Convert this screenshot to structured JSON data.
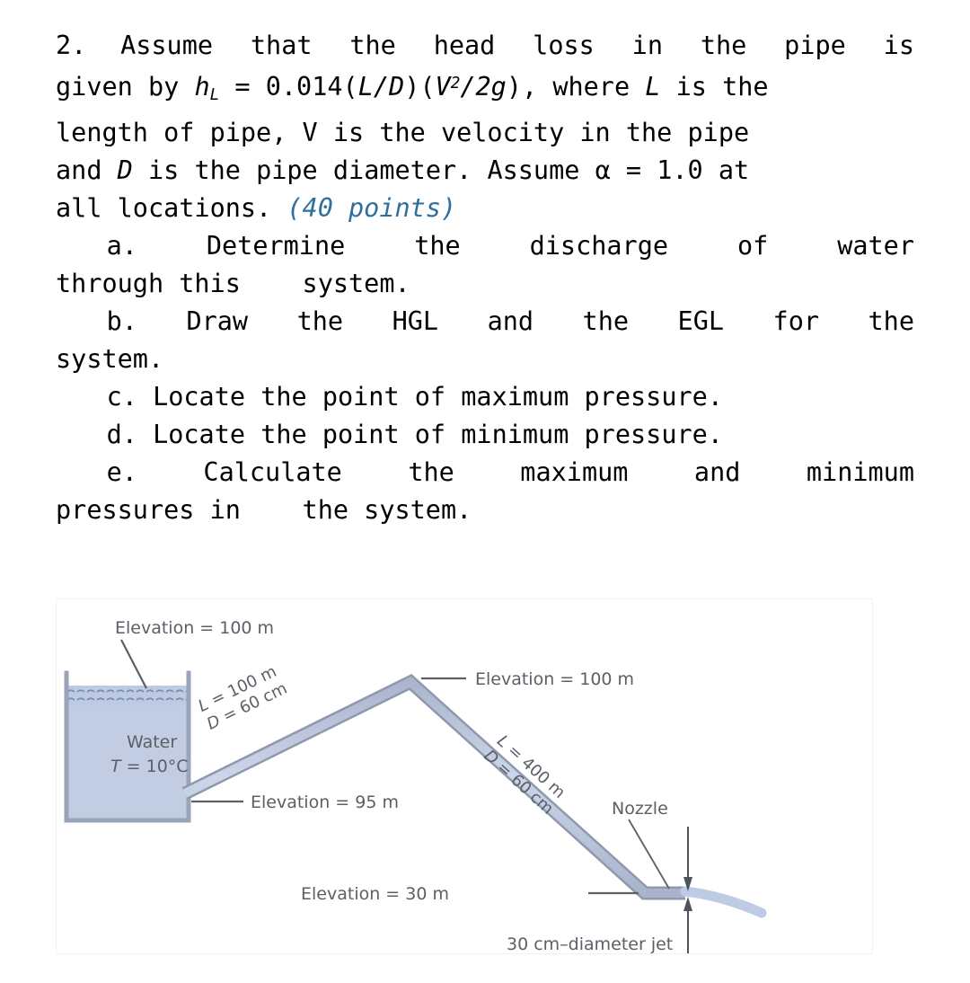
{
  "problem": {
    "number": "2.",
    "lines": [
      "2.    Assume that the head loss in the pipe is",
      "given by h_L = 0.014(L/D)(V^2/2g), where L is the",
      "length of pipe, V is the velocity in the pipe",
      "and D is the pipe diameter. Assume α = 1.0 at",
      "all locations. (40 points)"
    ],
    "body_text": "Assume that the head loss in the pipe is given by h",
    "formula": {
      "h": "h",
      "h_sub": "L",
      "equals": " = 0.014(",
      "L": "L",
      "slash": "/",
      "D": "D",
      "close_open": ")(",
      "V": "V",
      "V_sup": "2",
      "over2g": "/2",
      "g": "g",
      "close": "),"
    },
    "seg_where": " where ",
    "seg_L2": "L",
    "seg_is_the": " is the",
    "line3": "length of pipe, V is the velocity in the pipe",
    "line4_a": "and ",
    "line4_D": "D",
    "line4_b": " is the pipe diameter. Assume α = 1.0 at",
    "line5_a": "all locations. ",
    "points_label": "(40 points)",
    "points_color": "#2e6f9e",
    "items": [
      {
        "key": "a",
        "line1": "a.  Determine  the  discharge  of  water",
        "line2": "through this    system."
      },
      {
        "key": "b",
        "line1": "b.  Draw  the  HGL  and  the  EGL  for  the",
        "line2": "system."
      },
      {
        "key": "c",
        "line1": "c. Locate the point of maximum pressure.",
        "line2": ""
      },
      {
        "key": "d",
        "line1": "d. Locate the point of minimum pressure.",
        "line2": ""
      },
      {
        "key": "e",
        "line1": "e.  Calculate  the  maximum  and  minimum",
        "line2": "pressures in    the system."
      }
    ]
  },
  "figure": {
    "title": "pipe-system-schematic",
    "colors": {
      "water_fill": "#c2cde3",
      "water_fill_top": "#bcc9e2",
      "tank_wall": "#9aa4b8",
      "pipe_fill": "#c2cde3",
      "pipe_edge": "#8f98ad",
      "label_text": "#5a6066",
      "leader": "#5a6066",
      "jet": "#b8c7e2"
    },
    "labels": {
      "elev_tank": "Elevation = 100 m",
      "elev_apex": "Elevation = 100 m",
      "elev_outlet_tank": "Elevation = 95 m",
      "elev_nozzle": "Elevation = 30 m",
      "tank_fluid": "Water",
      "tank_temp_T": "T",
      "tank_temp_rest": " = 10°C",
      "pipe1_L": "L",
      "pipe1_L_val": " = 100 m",
      "pipe1_D": "D",
      "pipe1_D_val": " = 60 cm",
      "pipe2_L": "L",
      "pipe2_L_val": " = 400 m",
      "pipe2_D": "D",
      "pipe2_D_val": " = 60 cm",
      "nozzle": "Nozzle",
      "jet": "30 cm–diameter jet"
    }
  }
}
